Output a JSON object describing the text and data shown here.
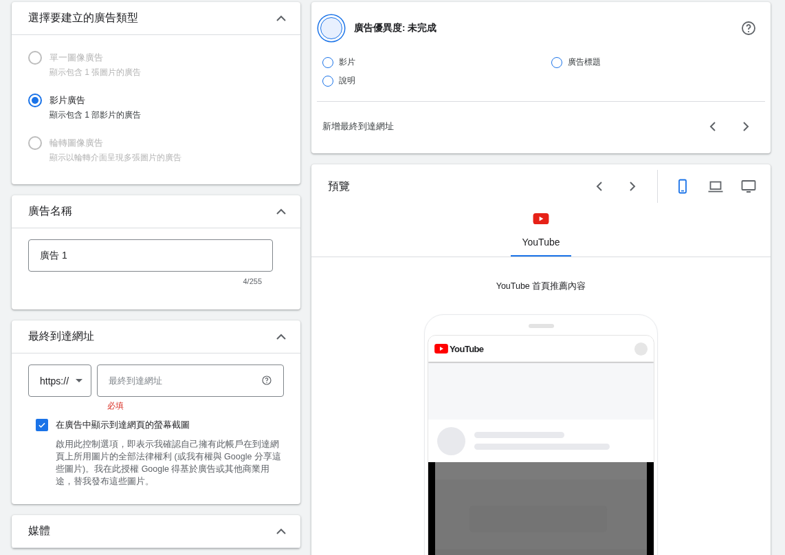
{
  "ad_type_card": {
    "title": "選擇要建立的廣告類型",
    "expanded": true,
    "options": [
      {
        "label": "單一圖像廣告",
        "description": "顯示包含 1 張圖片的廣告",
        "selected": false,
        "disabled": true
      },
      {
        "label": "影片廣告",
        "description": "顯示包含 1 部影片的廣告",
        "selected": true,
        "disabled": false
      },
      {
        "label": "輪轉圖像廣告",
        "description": "顯示以輪轉介面呈現多張圖片的廣告",
        "selected": false,
        "disabled": true
      }
    ]
  },
  "ad_name_card": {
    "title": "廣告名稱",
    "expanded": true,
    "field": {
      "value": "廣告 1",
      "counter": "4/255"
    }
  },
  "final_url_card": {
    "title": "最終到達網址",
    "expanded": true,
    "protocol": "https://",
    "url_field": {
      "placeholder": "最終到達網址"
    },
    "error": "必填",
    "screenshot_checkbox": {
      "label": "在廣告中顯示到達網頁的螢幕截圖",
      "checked": true,
      "description": "啟用此控制選項，即表示我確認自己擁有此帳戶在到達網頁上所用圖片的全部法律權利 (或我有權與 Google 分享這些圖片)。我在此授權 Google 得基於廣告或其他商業用途，替我發布這些圖片。"
    }
  },
  "media_card": {
    "title": "媒體",
    "expanded": true
  },
  "ad_strength": {
    "title": "廣告優異度: 未完成",
    "items": [
      {
        "label": "影片",
        "done": false
      },
      {
        "label": "廣告標題",
        "done": false
      },
      {
        "label": "說明",
        "done": false
      }
    ],
    "footer": "新增最終到達網址"
  },
  "preview": {
    "title": "預覽",
    "devices": [
      {
        "kind": "mobile",
        "selected": true
      },
      {
        "kind": "laptop",
        "selected": false
      },
      {
        "kind": "desktop",
        "selected": false
      }
    ],
    "tabs": [
      {
        "label": "YouTube",
        "selected": true
      }
    ],
    "placement": "YouTube 首頁推薦內容",
    "phone": {
      "logo_text": "YouTube"
    }
  }
}
